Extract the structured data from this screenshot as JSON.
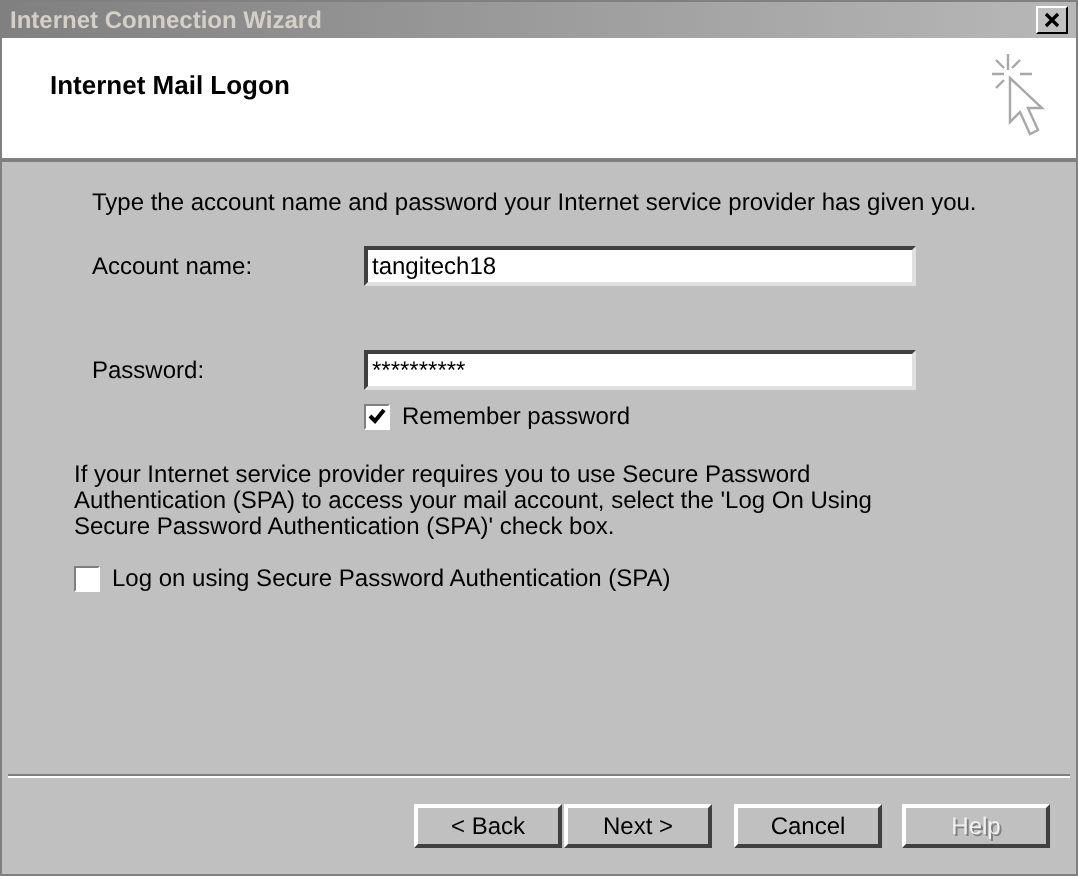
{
  "window": {
    "title": "Internet Connection Wizard",
    "active": false
  },
  "header": {
    "title": "Internet Mail Logon"
  },
  "intro": "Type the account name and password your Internet service provider has given you.",
  "fields": [
    {
      "label": "Account name:",
      "value": "tangitech18"
    },
    {
      "label": "Password:",
      "value": "**********"
    }
  ],
  "remember_password": {
    "label": "Remember password",
    "checked": true
  },
  "spa_note": "If your Internet service provider requires you to use Secure Password Authentication (SPA) to access your mail account, select the 'Log On Using Secure Password Authentication (SPA)' check box.",
  "spa": {
    "label": "Log on using Secure Password Authentication (SPA)",
    "checked": false
  },
  "buttons": [
    {
      "label": "< Back",
      "disabled": false
    },
    {
      "label": "Next >",
      "disabled": false
    },
    {
      "label": "Cancel",
      "disabled": false
    },
    {
      "label": "Help",
      "disabled": true
    }
  ]
}
